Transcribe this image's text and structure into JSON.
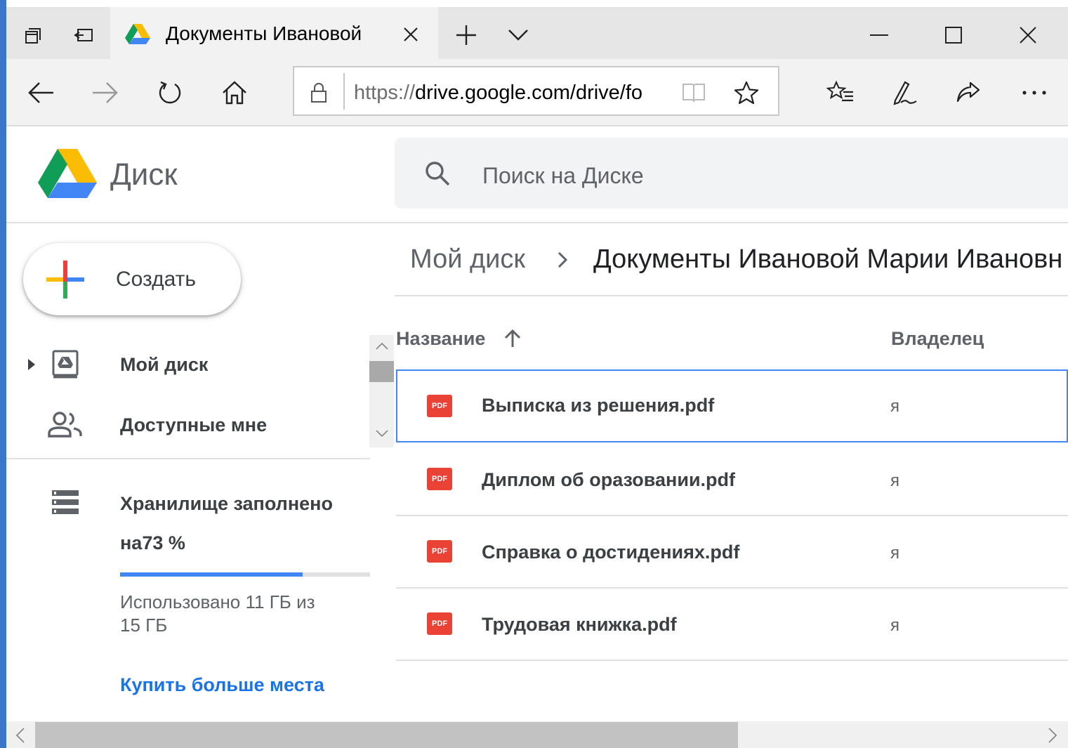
{
  "browser": {
    "tab_title": "Документы Ивановой",
    "url": "https://drive.google.com/drive/fo",
    "url_gray_prefix": "https://",
    "url_main": "drive.google.com/drive/fo"
  },
  "drive": {
    "app_title": "Диск",
    "search_placeholder": "Поиск на Диске",
    "create_label": "Создать",
    "nav": [
      {
        "label": "Мой диск"
      },
      {
        "label": "Доступные мне"
      }
    ],
    "storage": {
      "line1": "Хранилище заполнено",
      "line2": "на73 %",
      "used_fraction": 0.73,
      "used_line1": "Использовано 11 ГБ из",
      "used_line2": "15 ГБ",
      "buy_more": "Купить больше места"
    },
    "breadcrumb": {
      "root": "Мой диск",
      "separator": "›",
      "current": "Документы Ивановой Марии Ивановн"
    },
    "columns": {
      "name": "Название",
      "owner": "Владелец"
    },
    "files": [
      {
        "name": "Выписка из решения.pdf",
        "owner": "я",
        "type": "PDF"
      },
      {
        "name": "Диплом об оразовании.pdf",
        "owner": "я",
        "type": "PDF"
      },
      {
        "name": "Справка о достидениях.pdf",
        "owner": "я",
        "type": "PDF"
      },
      {
        "name": "Трудовая книжка.pdf",
        "owner": "я",
        "type": "PDF"
      }
    ]
  },
  "colors": {
    "accent_blue": "#4285f4",
    "link_blue": "#1a73e8",
    "pdf_red": "#ea4335"
  }
}
